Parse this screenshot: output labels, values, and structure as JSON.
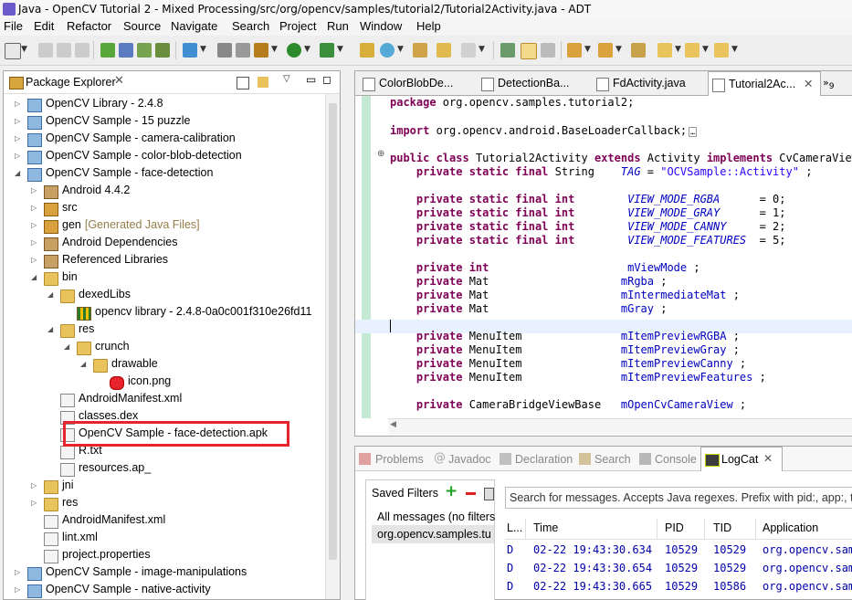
{
  "window": {
    "title": "Java - OpenCV Tutorial 2 - Mixed Processing/src/org/opencv/samples/tutorial2/Tutorial2Activity.java - ADT"
  },
  "menu": [
    "File",
    "Edit",
    "Refactor",
    "Source",
    "Navigate",
    "Search",
    "Project",
    "Run",
    "Window",
    "Help"
  ],
  "package_explorer": {
    "title": "Package Explorer",
    "tree": [
      {
        "label": "OpenCV Library - 2.4.8",
        "depth": 0,
        "twisty": "closed",
        "icon": "project"
      },
      {
        "label": "OpenCV Sample - 15 puzzle",
        "depth": 0,
        "twisty": "closed",
        "icon": "project"
      },
      {
        "label": "OpenCV Sample - camera-calibration",
        "depth": 0,
        "twisty": "closed",
        "icon": "project"
      },
      {
        "label": "OpenCV Sample - color-blob-detection",
        "depth": 0,
        "twisty": "closed",
        "icon": "project"
      },
      {
        "label": "OpenCV Sample - face-detection",
        "depth": 0,
        "twisty": "open",
        "icon": "project"
      },
      {
        "label": "Android 4.4.2",
        "depth": 1,
        "twisty": "closed",
        "icon": "library"
      },
      {
        "label": "src",
        "depth": 1,
        "twisty": "closed",
        "icon": "package"
      },
      {
        "label": "gen",
        "suffix": "[Generated Java Files]",
        "depth": 1,
        "twisty": "closed",
        "icon": "package"
      },
      {
        "label": "Android Dependencies",
        "depth": 1,
        "twisty": "closed",
        "icon": "library"
      },
      {
        "label": "Referenced Libraries",
        "depth": 1,
        "twisty": "closed",
        "icon": "library"
      },
      {
        "label": "bin",
        "depth": 1,
        "twisty": "open",
        "icon": "folder"
      },
      {
        "label": "dexedLibs",
        "depth": 2,
        "twisty": "open",
        "icon": "folder"
      },
      {
        "label": "opencv library - 2.4.8-0a0c001f310e26fd11",
        "depth": 3,
        "twisty": "none",
        "icon": "jar"
      },
      {
        "label": "res",
        "depth": 2,
        "twisty": "open",
        "icon": "folder"
      },
      {
        "label": "crunch",
        "depth": 3,
        "twisty": "open",
        "icon": "folder"
      },
      {
        "label": "drawable",
        "depth": 4,
        "twisty": "open",
        "icon": "folder"
      },
      {
        "label": "icon.png",
        "depth": 5,
        "twisty": "none",
        "icon": "image"
      },
      {
        "label": "AndroidManifest.xml",
        "depth": 2,
        "twisty": "none",
        "icon": "xml"
      },
      {
        "label": "classes.dex",
        "depth": 2,
        "twisty": "none",
        "icon": "file"
      },
      {
        "label": "OpenCV Sample - face-detection.apk",
        "depth": 2,
        "twisty": "none",
        "icon": "file",
        "highlight": true
      },
      {
        "label": "R.txt",
        "depth": 2,
        "twisty": "none",
        "icon": "file"
      },
      {
        "label": "resources.ap_",
        "depth": 2,
        "twisty": "none",
        "icon": "file"
      },
      {
        "label": "jni",
        "depth": 1,
        "twisty": "closed",
        "icon": "folder"
      },
      {
        "label": "res",
        "depth": 1,
        "twisty": "closed",
        "icon": "folder"
      },
      {
        "label": "AndroidManifest.xml",
        "depth": 1,
        "twisty": "none",
        "icon": "xml"
      },
      {
        "label": "lint.xml",
        "depth": 1,
        "twisty": "none",
        "icon": "xml"
      },
      {
        "label": "project.properties",
        "depth": 1,
        "twisty": "none",
        "icon": "file"
      },
      {
        "label": "OpenCV Sample - image-manipulations",
        "depth": 0,
        "twisty": "closed",
        "icon": "project"
      },
      {
        "label": "OpenCV Sample - native-activity",
        "depth": 0,
        "twisty": "closed",
        "icon": "project"
      }
    ]
  },
  "editor": {
    "tabs": [
      {
        "label": "ColorBlobDe...",
        "active": false
      },
      {
        "label": "DetectionBa...",
        "active": false
      },
      {
        "label": "FdActivity.java",
        "active": false
      },
      {
        "label": "Tutorial2Ac...",
        "active": true
      }
    ],
    "overflow_count": "9",
    "code": [
      {
        "t": 0,
        "parts": [
          [
            "kw",
            "package"
          ],
          [
            "",
            "org.opencv.samples.tutorial2;"
          ]
        ]
      },
      {
        "t": 1,
        "parts": [
          [
            "kw",
            "import"
          ],
          [
            "",
            "org.opencv.android.BaseLoaderCallback;"
          ]
        ],
        "collapsed": true
      },
      {
        "t": 2,
        "parts": [
          [
            "kw",
            "public"
          ],
          [
            "kw",
            "class"
          ],
          [
            "",
            "Tutorial2Activity"
          ],
          [
            "kw",
            "extends"
          ],
          [
            "",
            "Activity"
          ],
          [
            "kw",
            "implements"
          ],
          [
            "",
            "CvCameraViewLi"
          ]
        ]
      },
      {
        "t": 3,
        "parts": [
          [
            "",
            "    "
          ],
          [
            "kw",
            "private static final"
          ],
          [
            "",
            "String    "
          ],
          [
            "cst",
            "TAG"
          ],
          [
            "",
            "= "
          ],
          [
            "str",
            "\"OCVSample::Activity\""
          ],
          [
            "",
            ";"
          ]
        ]
      },
      {
        "t": 4,
        "parts": [
          [
            "",
            "    "
          ],
          [
            "kw",
            "private static final int"
          ],
          [
            "",
            "       "
          ],
          [
            "cst",
            "VIEW_MODE_RGBA"
          ],
          [
            "",
            "     = 0;"
          ]
        ]
      },
      {
        "t": 5,
        "parts": [
          [
            "",
            "    "
          ],
          [
            "kw",
            "private static final int"
          ],
          [
            "",
            "       "
          ],
          [
            "cst",
            "VIEW_MODE_GRAY"
          ],
          [
            "",
            "     = 1;"
          ]
        ]
      },
      {
        "t": 6,
        "parts": [
          [
            "",
            "    "
          ],
          [
            "kw",
            "private static final int"
          ],
          [
            "",
            "       "
          ],
          [
            "cst",
            "VIEW_MODE_CANNY"
          ],
          [
            "",
            "    = 2;"
          ]
        ]
      },
      {
        "t": 7,
        "parts": [
          [
            "",
            "    "
          ],
          [
            "kw",
            "private static final int"
          ],
          [
            "",
            "       "
          ],
          [
            "cst",
            "VIEW_MODE_FEATURES"
          ],
          [
            "",
            " = 5;"
          ]
        ]
      },
      {
        "t": 8,
        "parts": [
          [
            "",
            "    "
          ],
          [
            "kw",
            "private int"
          ],
          [
            "",
            "                    "
          ],
          [
            "fld",
            "mViewMode"
          ],
          [
            "",
            ";"
          ]
        ]
      },
      {
        "t": 9,
        "parts": [
          [
            "",
            "    "
          ],
          [
            "kw",
            "private"
          ],
          [
            "",
            "Mat                    "
          ],
          [
            "fld",
            "mRgba"
          ],
          [
            "",
            ";"
          ]
        ]
      },
      {
        "t": 10,
        "parts": [
          [
            "",
            "    "
          ],
          [
            "kw",
            "private"
          ],
          [
            "",
            "Mat                    "
          ],
          [
            "fld",
            "mIntermediateMat"
          ],
          [
            "",
            ";"
          ]
        ]
      },
      {
        "t": 11,
        "parts": [
          [
            "",
            "    "
          ],
          [
            "kw",
            "private"
          ],
          [
            "",
            "Mat                    "
          ],
          [
            "fld",
            "mGray"
          ],
          [
            "",
            ";"
          ]
        ]
      },
      {
        "t": 12,
        "parts": [
          [
            "",
            "    "
          ],
          [
            "kw",
            "private"
          ],
          [
            "",
            "MenuItem               "
          ],
          [
            "fld",
            "mItemPreviewRGBA"
          ],
          [
            "",
            ";"
          ]
        ]
      },
      {
        "t": 13,
        "parts": [
          [
            "",
            "    "
          ],
          [
            "kw",
            "private"
          ],
          [
            "",
            "MenuItem               "
          ],
          [
            "fld",
            "mItemPreviewGray"
          ],
          [
            "",
            ";"
          ]
        ]
      },
      {
        "t": 14,
        "parts": [
          [
            "",
            "    "
          ],
          [
            "kw",
            "private"
          ],
          [
            "",
            "MenuItem               "
          ],
          [
            "fld",
            "mItemPreviewCanny"
          ],
          [
            "",
            ";"
          ]
        ]
      },
      {
        "t": 15,
        "parts": [
          [
            "",
            "    "
          ],
          [
            "kw",
            "private"
          ],
          [
            "",
            "MenuItem               "
          ],
          [
            "fld",
            "mItemPreviewFeatures"
          ],
          [
            "",
            ";"
          ]
        ]
      },
      {
        "t": 16,
        "parts": [
          [
            "",
            "    "
          ],
          [
            "kw",
            "private"
          ],
          [
            "",
            "CameraBridgeViewBase   "
          ],
          [
            "fld",
            "mOpenCvCameraView"
          ],
          [
            "",
            ";"
          ]
        ]
      }
    ]
  },
  "bottom_panel": {
    "tabs": [
      "Problems",
      "Javadoc",
      "Declaration",
      "Search",
      "Console",
      "LogCat"
    ],
    "active_tab": "LogCat",
    "saved_filters": {
      "title": "Saved Filters",
      "items": [
        "All messages (no filters",
        "org.opencv.samples.tu"
      ]
    },
    "search_placeholder": "Search for messages. Accepts Java regexes. Prefix with pid:, app:, ta",
    "columns": [
      "L...",
      "Time",
      "PID",
      "TID",
      "Application"
    ],
    "rows": [
      {
        "level": "D",
        "time": "02-22 19:43:30.634",
        "pid": "10529",
        "tid": "10529",
        "app": "org.opencv.sam"
      },
      {
        "level": "D",
        "time": "02-22 19:43:30.654",
        "pid": "10529",
        "tid": "10529",
        "app": "org.opencv.sam"
      },
      {
        "level": "D",
        "time": "02-22 19:43:30.665",
        "pid": "10529",
        "tid": "10586",
        "app": "org.opencv.sam"
      }
    ]
  }
}
